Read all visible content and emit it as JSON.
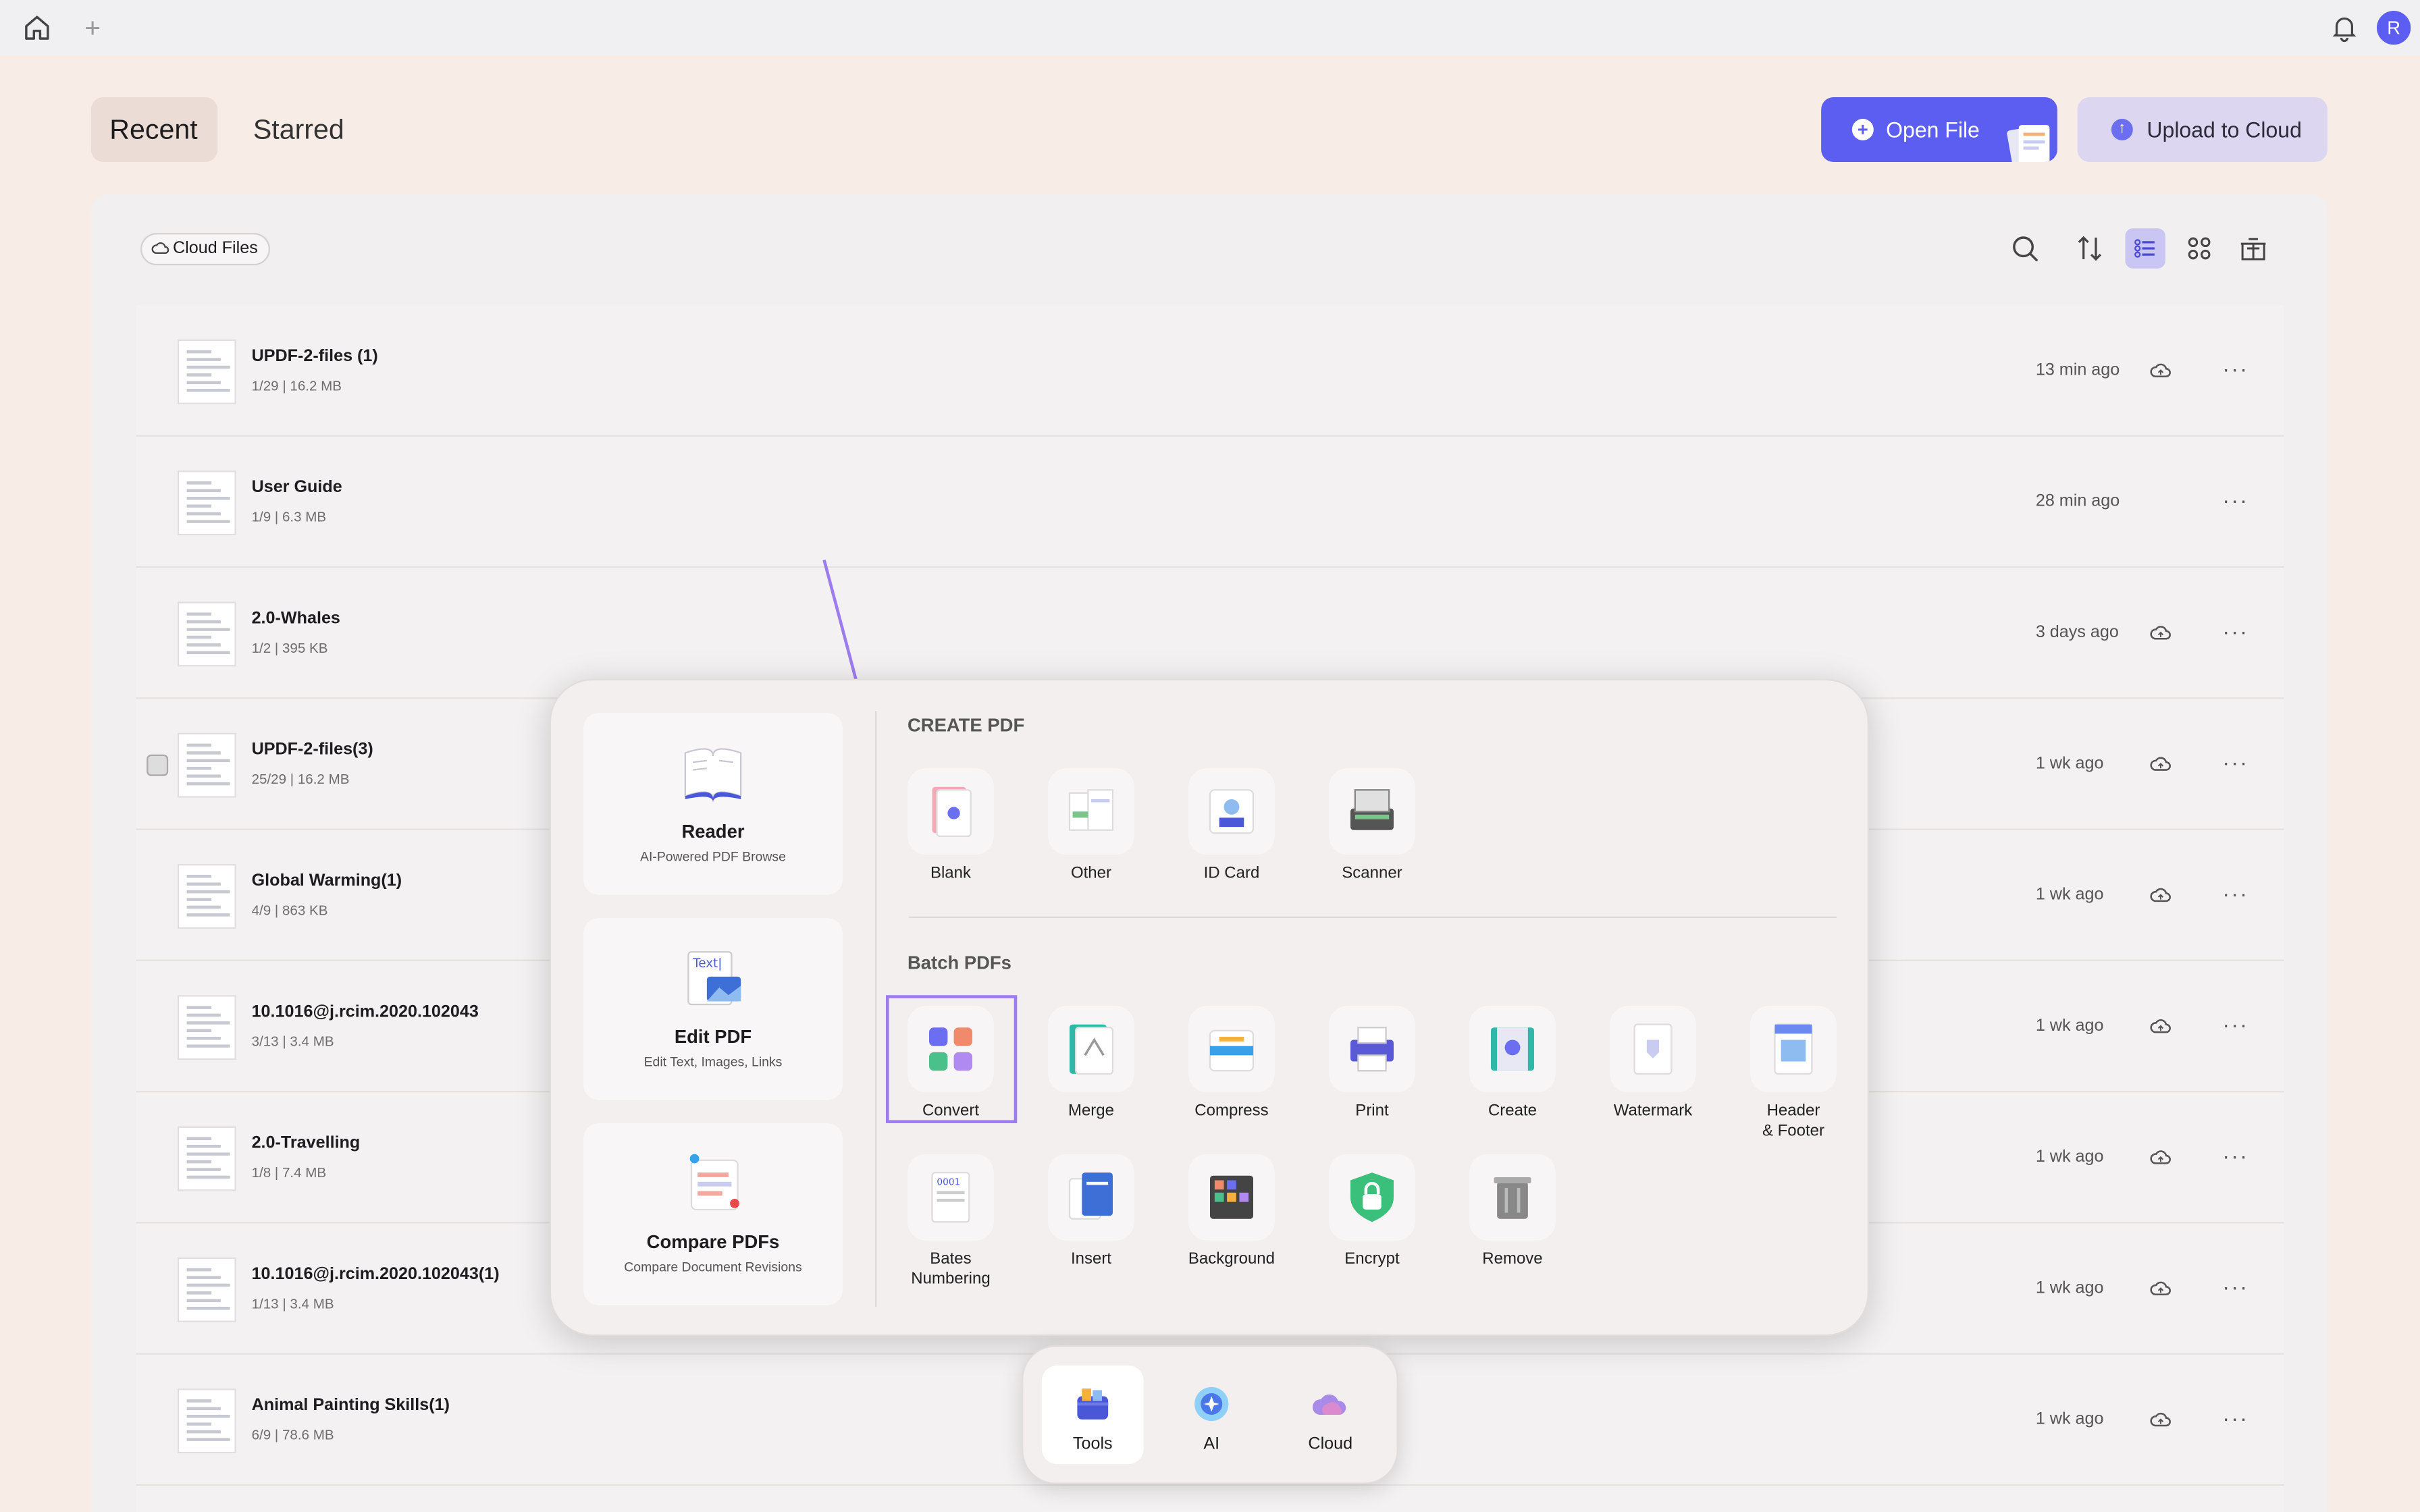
{
  "topbar": {
    "avatar_initial": "R",
    "add_tab": "+"
  },
  "tabs": {
    "recent": "Recent",
    "starred": "Starred"
  },
  "actions": {
    "open_file": "Open File",
    "upload_cloud": "Upload to Cloud"
  },
  "filter": {
    "cloud_files": "Cloud Files"
  },
  "files": [
    {
      "name": "UPDF-2-files (1)",
      "meta": "1/29  |  16.2 MB",
      "time": "13 min ago",
      "cloud": true
    },
    {
      "name": "User Guide",
      "meta": "1/9  |  6.3 MB",
      "time": "28 min ago",
      "cloud": false
    },
    {
      "name": "2.0-Whales",
      "meta": "1/2  |  395 KB",
      "time": "3 days ago",
      "cloud": true
    },
    {
      "name": "UPDF-2-files(3)",
      "meta": "25/29  |  16.2 MB",
      "time": "1 wk ago",
      "cloud": true
    },
    {
      "name": "Global Warming(1)",
      "meta": "4/9  |  863 KB",
      "time": "1 wk ago",
      "cloud": true
    },
    {
      "name": "10.1016@j.rcim.2020.102043",
      "meta": "3/13  |  3.4 MB",
      "time": "1 wk ago",
      "cloud": true
    },
    {
      "name": "2.0-Travelling",
      "meta": "1/8  |  7.4 MB",
      "time": "1 wk ago",
      "cloud": true
    },
    {
      "name": "10.1016@j.rcim.2020.102043(1)",
      "meta": "1/13  |  3.4 MB",
      "time": "1 wk ago",
      "cloud": true
    },
    {
      "name": "Animal Painting Skills(1)",
      "meta": "6/9  |  78.6 MB",
      "time": "1 wk ago",
      "cloud": true
    }
  ],
  "popup": {
    "cards": [
      {
        "title": "Reader",
        "sub": "AI-Powered PDF Browse"
      },
      {
        "title": "Edit PDF",
        "sub": "Edit Text, Images, Links"
      },
      {
        "title": "Compare PDFs",
        "sub": "Compare Document Revisions"
      }
    ],
    "create_title": "CREATE PDF",
    "create_tools": [
      "Blank",
      "Other",
      "ID Card",
      "Scanner"
    ],
    "batch_title": "Batch PDFs",
    "batch_tools": [
      "Convert",
      "Merge",
      "Compress",
      "Print",
      "Create",
      "Watermark",
      "Header\n& Footer",
      "Bates\nNumbering",
      "Insert",
      "Background",
      "Encrypt",
      "Remove"
    ]
  },
  "dock": {
    "tools": "Tools",
    "ai": "AI",
    "cloud": "Cloud"
  },
  "colors": {
    "accent": "#5b5ef0",
    "highlight": "#9d7cf0"
  }
}
